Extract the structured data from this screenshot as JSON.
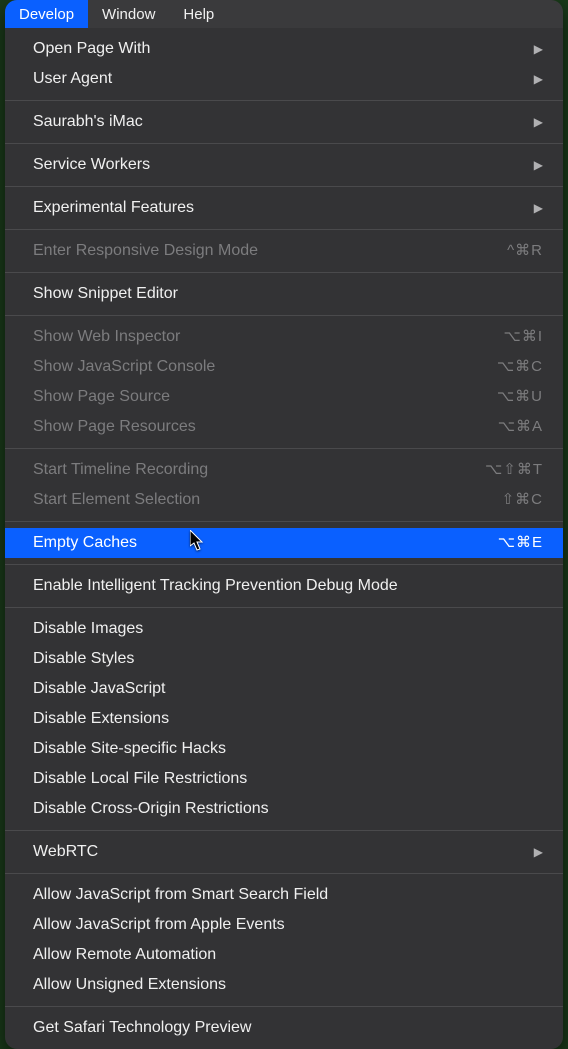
{
  "menubar": {
    "items": [
      {
        "label": "Develop",
        "active": true
      },
      {
        "label": "Window",
        "active": false
      },
      {
        "label": "Help",
        "active": false
      }
    ]
  },
  "menu": {
    "groups": [
      [
        {
          "label": "Open Page With",
          "submenu": true,
          "disabled": false
        },
        {
          "label": "User Agent",
          "submenu": true,
          "disabled": false
        }
      ],
      [
        {
          "label": "Saurabh's iMac",
          "submenu": true,
          "disabled": false
        }
      ],
      [
        {
          "label": "Service Workers",
          "submenu": true,
          "disabled": false
        }
      ],
      [
        {
          "label": "Experimental Features",
          "submenu": true,
          "disabled": false
        }
      ],
      [
        {
          "label": "Enter Responsive Design Mode",
          "shortcut": "^⌘R",
          "disabled": true
        }
      ],
      [
        {
          "label": "Show Snippet Editor",
          "disabled": false
        }
      ],
      [
        {
          "label": "Show Web Inspector",
          "shortcut": "⌥⌘I",
          "disabled": true
        },
        {
          "label": "Show JavaScript Console",
          "shortcut": "⌥⌘C",
          "disabled": true
        },
        {
          "label": "Show Page Source",
          "shortcut": "⌥⌘U",
          "disabled": true
        },
        {
          "label": "Show Page Resources",
          "shortcut": "⌥⌘A",
          "disabled": true
        }
      ],
      [
        {
          "label": "Start Timeline Recording",
          "shortcut": "⌥⇧⌘T",
          "disabled": true
        },
        {
          "label": "Start Element Selection",
          "shortcut": "⇧⌘C",
          "disabled": true
        }
      ],
      [
        {
          "label": "Empty Caches",
          "shortcut": "⌥⌘E",
          "disabled": false,
          "highlighted": true
        }
      ],
      [
        {
          "label": "Enable Intelligent Tracking Prevention Debug Mode",
          "disabled": false
        }
      ],
      [
        {
          "label": "Disable Images",
          "disabled": false
        },
        {
          "label": "Disable Styles",
          "disabled": false
        },
        {
          "label": "Disable JavaScript",
          "disabled": false
        },
        {
          "label": "Disable Extensions",
          "disabled": false
        },
        {
          "label": "Disable Site-specific Hacks",
          "disabled": false
        },
        {
          "label": "Disable Local File Restrictions",
          "disabled": false
        },
        {
          "label": "Disable Cross-Origin Restrictions",
          "disabled": false
        }
      ],
      [
        {
          "label": "WebRTC",
          "submenu": true,
          "disabled": false
        }
      ],
      [
        {
          "label": "Allow JavaScript from Smart Search Field",
          "disabled": false
        },
        {
          "label": "Allow JavaScript from Apple Events",
          "disabled": false
        },
        {
          "label": "Allow Remote Automation",
          "disabled": false
        },
        {
          "label": "Allow Unsigned Extensions",
          "disabled": false
        }
      ],
      [
        {
          "label": "Get Safari Technology Preview",
          "disabled": false
        }
      ]
    ]
  }
}
